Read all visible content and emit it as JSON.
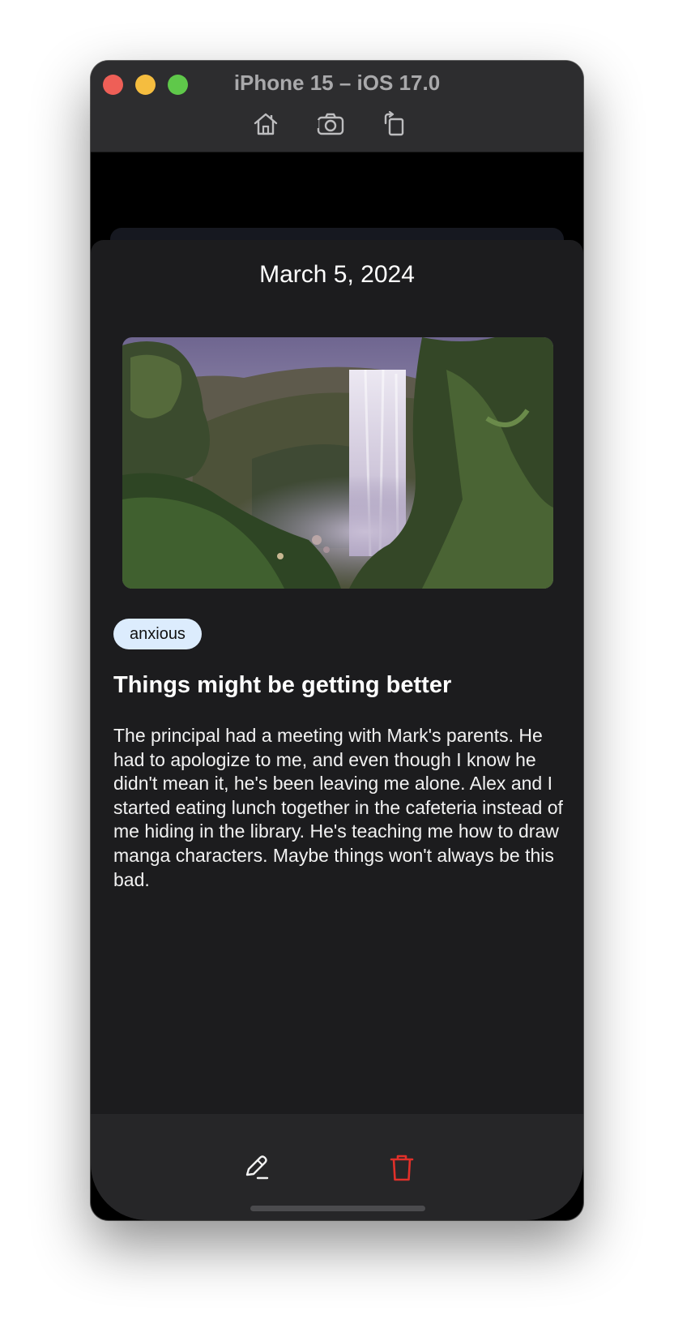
{
  "window": {
    "title": "iPhone 15 – iOS 17.0",
    "toolbar": [
      "home-icon",
      "screenshot-icon",
      "rotate-icon"
    ]
  },
  "entry": {
    "date": "March 5, 2024",
    "mood": "anxious",
    "title": "Things might be getting better",
    "body": "The principal had a meeting with Mark's parents. He had to apologize to me, and even though I know he didn't mean it, he's been leaving me alone. Alex and I started eating lunch together in the cafeteria instead of me hiding in the library. He's teaching me how to draw manga characters. Maybe things won't always be this bad.",
    "photo": "waterfall-photo"
  },
  "actions": {
    "edit_icon": "pencil-icon",
    "delete_icon": "trash-icon"
  },
  "colors": {
    "sheet_bg": "#1c1c1e",
    "bar_bg": "#262628",
    "tag_bg": "#dcecfd",
    "delete": "#e0302a",
    "titlebar": "#2d2d2f"
  }
}
